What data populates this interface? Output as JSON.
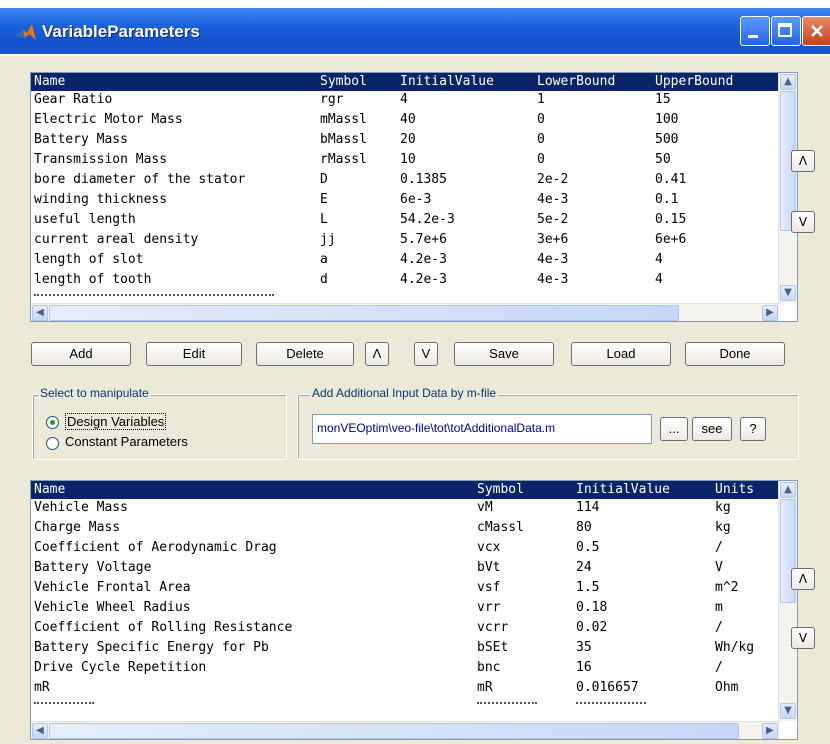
{
  "window": {
    "title": "VariableParameters"
  },
  "design_table": {
    "columns": [
      "Name",
      "Symbol",
      "InitialValue",
      "LowerBound",
      "UpperBound"
    ],
    "rows": [
      [
        "Gear Ratio",
        "rgr",
        "4",
        "1",
        "15"
      ],
      [
        "Electric Motor Mass",
        "mMassl",
        "40",
        "0",
        "100"
      ],
      [
        "Battery Mass",
        "bMassl",
        "20",
        "0",
        "500"
      ],
      [
        "Transmission Mass",
        "rMassl",
        "10",
        "0",
        "50"
      ],
      [
        "bore diameter of the stator",
        "D",
        "0.1385",
        "2e-2",
        "0.41"
      ],
      [
        "winding thickness",
        "E",
        "6e-3",
        "4e-3",
        "0.1"
      ],
      [
        "useful length",
        "L",
        "54.2e-3",
        "5e-2",
        "0.15"
      ],
      [
        "current areal density",
        "jj",
        "5.7e+6",
        "3e+6",
        "6e+6"
      ],
      [
        "length of slot",
        "a",
        "4.2e-3",
        "4e-3",
        "4"
      ],
      [
        "length of tooth",
        "d",
        "4.2e-3",
        "4e-3",
        "4"
      ]
    ]
  },
  "buttons": {
    "add": "Add",
    "edit": "Edit",
    "delete": "Delete",
    "up": "Λ",
    "down": "V",
    "save": "Save",
    "load": "Load",
    "done": "Done"
  },
  "side": {
    "up": "Λ",
    "down": "V"
  },
  "manipulate": {
    "title": "Select to manipulate",
    "option1": "Design Variables",
    "option2": "Constant Parameters",
    "selected": "Design Variables"
  },
  "additional": {
    "title": "Add Additional Input Data by m-file",
    "path": "monVEOptim\\veo-file\\tot\\totAdditionalData.m",
    "browse": "...",
    "see": "see",
    "help": "?"
  },
  "constant_table": {
    "columns": [
      "Name",
      "Symbol",
      "InitialValue",
      "Units"
    ],
    "rows": [
      [
        "Vehicle Mass",
        "vM",
        "114",
        "kg"
      ],
      [
        "Charge Mass",
        "cMassl",
        "80",
        "kg"
      ],
      [
        "Coefficient of Aerodynamic Drag",
        "vcx",
        "0.5",
        "/"
      ],
      [
        "Battery Voltage",
        "bVt",
        "24",
        "V"
      ],
      [
        "Vehicle Frontal Area",
        "vsf",
        "1.5",
        "m^2"
      ],
      [
        "Vehicle Wheel Radius",
        "vrr",
        "0.18",
        "m"
      ],
      [
        "Coefficient of Rolling Resistance",
        "vcrr",
        "0.02",
        "/"
      ],
      [
        "Battery Specific Energy for Pb",
        "bSEt",
        "35",
        "Wh/kg"
      ],
      [
        "Drive Cycle Repetition",
        "bnc",
        "16",
        "/"
      ],
      [
        "mR",
        "mR",
        "0.016657",
        "Ohm"
      ]
    ]
  }
}
